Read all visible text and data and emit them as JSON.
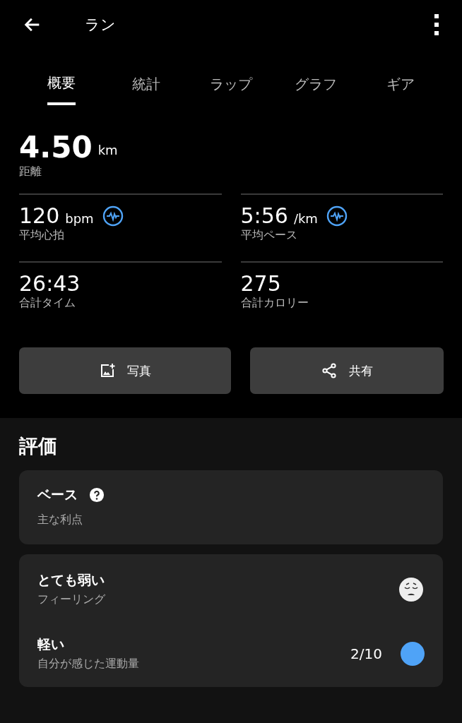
{
  "header": {
    "title": "ラン"
  },
  "tabs": [
    {
      "label": "概要",
      "selected": true
    },
    {
      "label": "統計",
      "selected": false
    },
    {
      "label": "ラップ",
      "selected": false
    },
    {
      "label": "グラフ",
      "selected": false
    },
    {
      "label": "ギア",
      "selected": false
    }
  ],
  "distance": {
    "value": "4.50",
    "unit": "km",
    "label": "距離"
  },
  "stats": [
    {
      "value": "120",
      "unit": "bpm",
      "label": "平均心拍",
      "chart_link": true
    },
    {
      "value": "5:56",
      "unit": "/km",
      "label": "平均ペース",
      "chart_link": true
    },
    {
      "value": "26:43",
      "label": "合計タイム",
      "chart_link": false
    },
    {
      "value": "275",
      "label": "合計カロリー",
      "chart_link": false
    }
  ],
  "buttons": [
    {
      "kind": "photo",
      "label": "写真"
    },
    {
      "kind": "share",
      "label": "共有"
    }
  ],
  "evaluation": {
    "title": "評価",
    "base": {
      "title": "ベース",
      "subtitle": "主な利点"
    },
    "rows": [
      {
        "kind": "feeling",
        "title": "とても弱い",
        "subtitle": "フィーリング"
      },
      {
        "kind": "effort",
        "title": "軽い",
        "subtitle": "自分が感じた運動量",
        "reading": "2/10",
        "color": "#4fa3f7"
      }
    ]
  }
}
